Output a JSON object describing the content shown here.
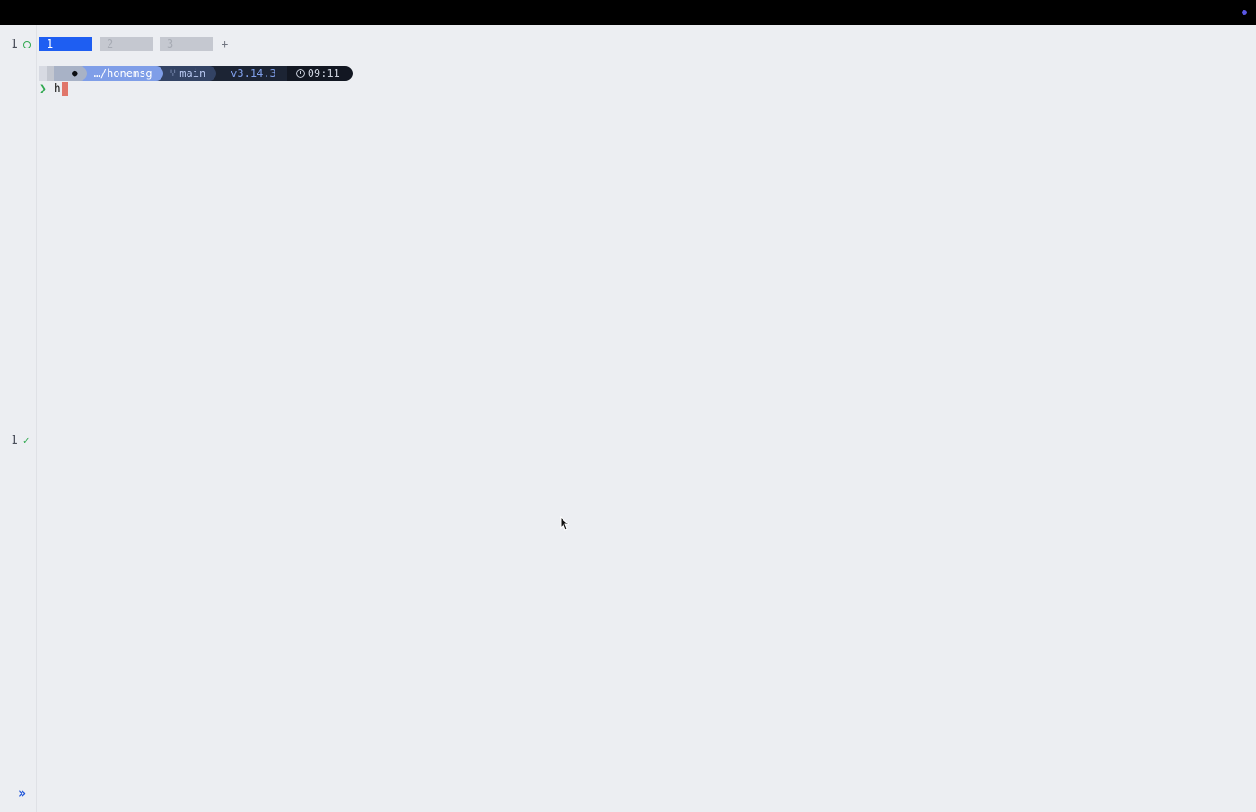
{
  "window": {
    "status_dot_color": "#5b57e6"
  },
  "gutter": {
    "top_row": {
      "number": "1",
      "icon": "circle-icon"
    },
    "bottom_row": {
      "number": "1",
      "icon": "check-icon"
    },
    "expand_glyph": "»"
  },
  "tabs": [
    {
      "label": "1",
      "active": true
    },
    {
      "label": "2",
      "active": false
    },
    {
      "label": "3",
      "active": false
    }
  ],
  "tab_add_label": "+",
  "prompt": {
    "os_icon": "apple-icon",
    "path": "…/honemsg",
    "branch": "main",
    "version": "v3.14.3",
    "time": "09:11"
  },
  "input": {
    "prompt_symbol": "❯",
    "text": "h"
  }
}
